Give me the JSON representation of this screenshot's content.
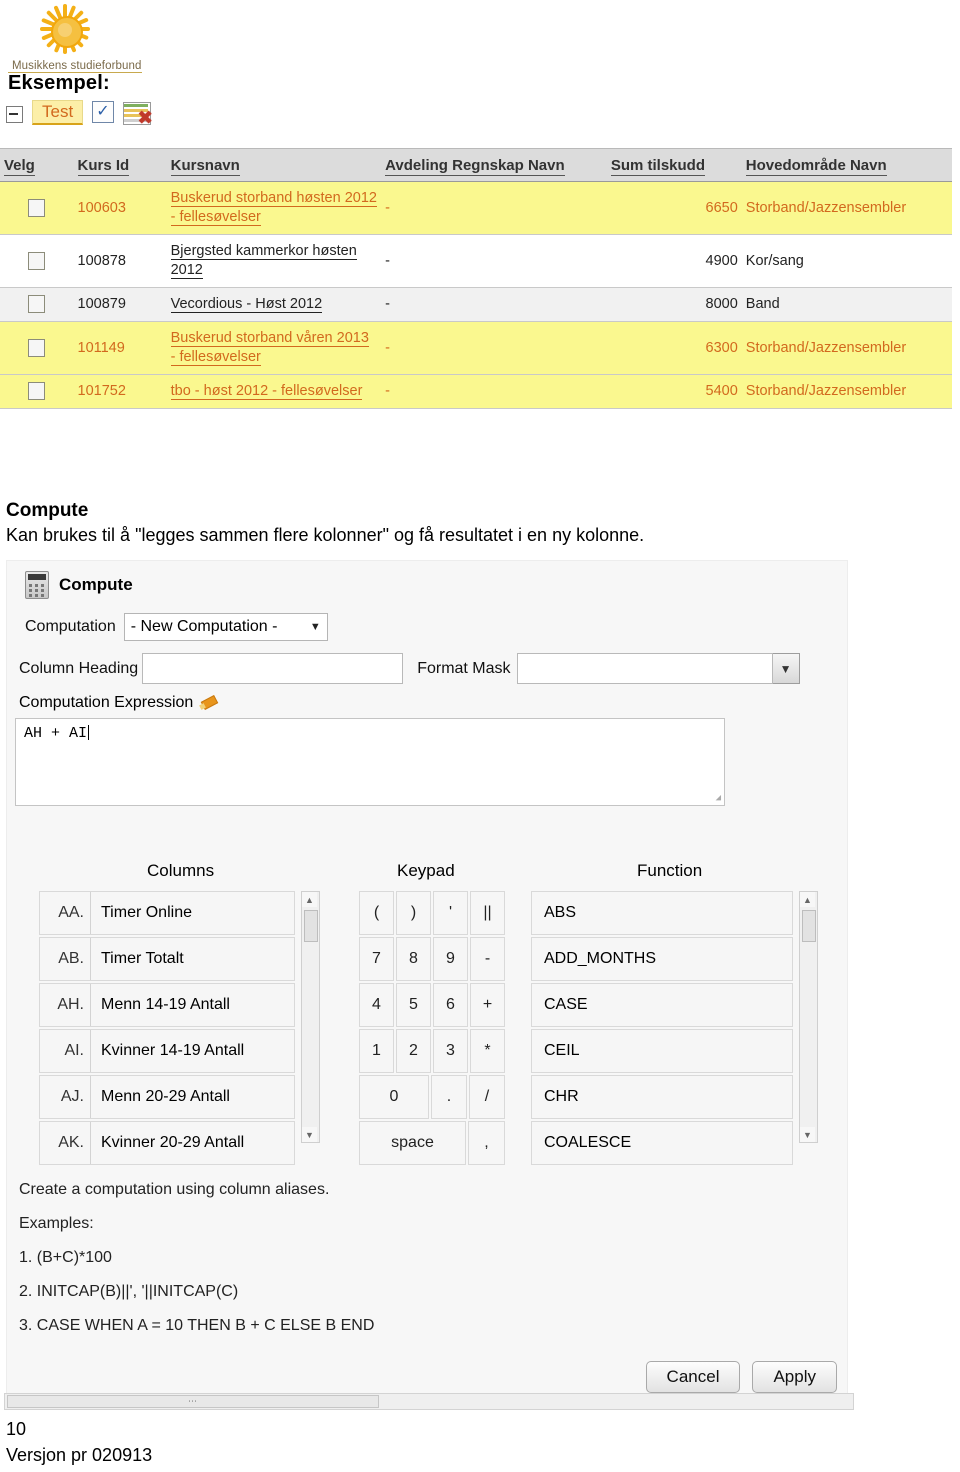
{
  "brand": {
    "name": "Musikkens studieforbund",
    "logo_icon": "sunflower-icon"
  },
  "heading": {
    "eksempel": "Eksempel:"
  },
  "toolbar": {
    "collapse_icon": "minus-box-icon",
    "tab_label": "Test",
    "check_icon": "checkbox-icon",
    "delete_grid_icon": "grid-delete-icon"
  },
  "report": {
    "columns": [
      "Velg",
      "Kurs Id",
      "Kursnavn",
      "Avdeling Regnskap Navn",
      "Sum tilskudd",
      "Hovedområde Navn"
    ],
    "rows": [
      {
        "kurs_id": "100603",
        "kursnavn": "Buskerud storband høsten 2012 - fellesøvelser",
        "avdeling": "-",
        "sum": "6650",
        "hovedomrade": "Storband/Jazzensembler",
        "highlight": "yellow"
      },
      {
        "kurs_id": "100878",
        "kursnavn": "Bjergsted kammerkor høsten 2012",
        "avdeling": "-",
        "sum": "4900",
        "hovedomrade": "Kor/sang",
        "highlight": "white"
      },
      {
        "kurs_id": "100879",
        "kursnavn": "Vecordious - Høst 2012",
        "avdeling": "-",
        "sum": "8000",
        "hovedomrade": "Band",
        "highlight": "grey"
      },
      {
        "kurs_id": "101149",
        "kursnavn": "Buskerud storband våren 2013 - fellesøvelser",
        "avdeling": "-",
        "sum": "6300",
        "hovedomrade": "Storband/Jazzensembler",
        "highlight": "yellow"
      },
      {
        "kurs_id": "101752",
        "kursnavn": "tbo - høst 2012 - fellesøvelser",
        "avdeling": "-",
        "sum": "5400",
        "hovedomrade": "Storband/Jazzensembler",
        "highlight": "yellow"
      }
    ]
  },
  "section": {
    "title": "Compute",
    "body": "Kan brukes til å \"legges sammen flere kolonner\" og få resultatet i en ny kolonne."
  },
  "dialog": {
    "title": "Compute",
    "title_icon": "calculator-icon",
    "computation_label": "Computation",
    "computation_value": "- New Computation -",
    "computation_arrow": "chevron-down-icon",
    "column_heading_label": "Column Heading",
    "column_heading_value": "",
    "column_heading_placeholder": "",
    "format_mask_label": "Format Mask",
    "format_mask_value": "",
    "format_mask_placeholder": "",
    "format_mask_arrow": "chevron-down-icon",
    "expression_label": "Computation Expression",
    "expression_icon": "pencil-icon",
    "expression_value": "AH + AI",
    "panels": {
      "columns_heading": "Columns",
      "keypad_heading": "Keypad",
      "function_heading": "Function"
    },
    "columns": [
      {
        "alias": "AA.",
        "label": "Timer Online"
      },
      {
        "alias": "AB.",
        "label": "Timer Totalt"
      },
      {
        "alias": "AH.",
        "label": "Menn 14-19 Antall"
      },
      {
        "alias": "AI.",
        "label": "Kvinner 14-19 Antall"
      },
      {
        "alias": "AJ.",
        "label": "Menn 20-29 Antall"
      },
      {
        "alias": "AK.",
        "label": "Kvinner 20-29 Antall"
      }
    ],
    "keypad": [
      [
        "(",
        ")",
        "'",
        "||"
      ],
      [
        "7",
        "8",
        "9",
        "-"
      ],
      [
        "4",
        "5",
        "6",
        "+"
      ],
      [
        "1",
        "2",
        "3",
        "*"
      ],
      [
        "0",
        ".",
        "/"
      ],
      [
        "space",
        ","
      ]
    ],
    "functions": [
      "ABS",
      "ADD_MONTHS",
      "CASE",
      "CEIL",
      "CHR",
      "COALESCE"
    ],
    "help": {
      "intro": "Create a computation using column aliases.",
      "examples_label": "Examples:",
      "example_1": "1. (B+C)*100",
      "example_2": "2. INITCAP(B)||', '||INITCAP(C)",
      "example_3": "3. CASE WHEN A = 10 THEN B + C ELSE B END"
    },
    "cancel_label": "Cancel",
    "apply_label": "Apply"
  },
  "footer": {
    "page_number": "10",
    "version": "Versjon pr 020913"
  }
}
